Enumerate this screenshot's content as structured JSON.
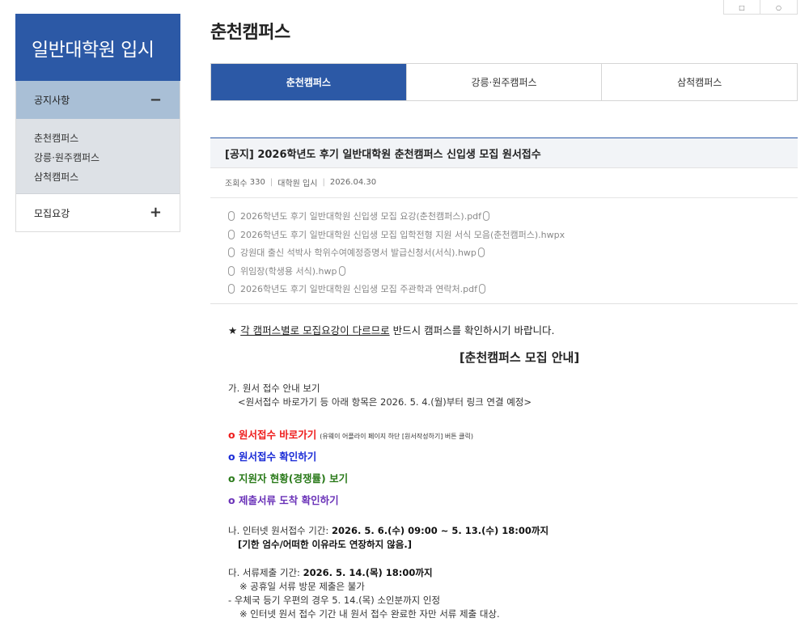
{
  "util": {
    "btn1": "□",
    "btn2": "○"
  },
  "sidebar": {
    "title": "일반대학원 입시",
    "menu_notice": "공지사항",
    "menu_notice_toggle": "−",
    "sub_items": [
      "춘천캠퍼스",
      "강릉·원주캠퍼스",
      "삼척캠퍼스"
    ],
    "menu_recruit": "모집요강",
    "menu_recruit_toggle": "+"
  },
  "main": {
    "page_title": "춘천캠퍼스",
    "tabs": [
      "춘천캠퍼스",
      "강릉·원주캠퍼스",
      "삼척캠퍼스"
    ],
    "post_title": "[공지] 2026학년도 후기 일반대학원 춘천캠퍼스 신입생 모집 원서접수",
    "meta": {
      "views_label": "조회수",
      "views": "330",
      "writer": "대학원 입시",
      "date": "2026.04.30"
    },
    "files": [
      "2026학년도 후기 일반대학원 신입생 모집 요강(춘천캠퍼스).pdf",
      "2026학년도 후기 일반대학원 신입생 모집 입학전형 지원 서식 모음(춘천캠퍼스).hwpx",
      "강원대 출신 석박사 학위수여예정증명서 발급신청서(서식).hwp",
      "위임장(학생용 서식).hwp",
      "2026학년도 후기 일반대학원 신입생 모집 주관학과 연락처.pdf"
    ],
    "notice_star": "★",
    "notice_underlined": "각 캠퍼스별로 모집요강이 다르므로",
    "notice_rest": " 반드시 캠퍼스를 확인하시기 바랍니다.",
    "section_title": "[춘천캠퍼스 모집 안내]",
    "ga_title": "가. 원서 접수 안내 보기",
    "ga_note": "<원서접수 바로가기 등 아래 항목은 2026. 5. 4.(월)부터 링크 연결 예정>",
    "link_apply": "o 원서접수 바로가기",
    "link_apply_note": "(유웨이 어플라이 페이지 하단 [원서작성하기] 버튼 클릭)",
    "link_check": "o 원서접수 확인하기",
    "link_status": "o 지원자 현황(경쟁률) 보기",
    "link_docs": "o 제출서류 도착 확인하기",
    "na_label": "나. 인터넷 원서접수 기간: ",
    "na_period": "2026. 5. 6.(수) 09:00 ~ 5. 13.(수) 18:00까지",
    "na_note": "[기한 엄수/어떠한 이유라도 연장하지 않음.]",
    "da_label": "다. 서류제출 기간: ",
    "da_period": "2026. 5. 14.(목) 18:00까지",
    "da_note1": "※ 공휴일 서류 방문 제출은 불가",
    "da_note2": "- 우체국 등기 우편의 경우 5. 14.(목) 소인분까지 인정",
    "da_note3": "※ 인터넷 원서 접수 기간 내 원서 접수 완료한 자만 서류 제출 대상."
  }
}
